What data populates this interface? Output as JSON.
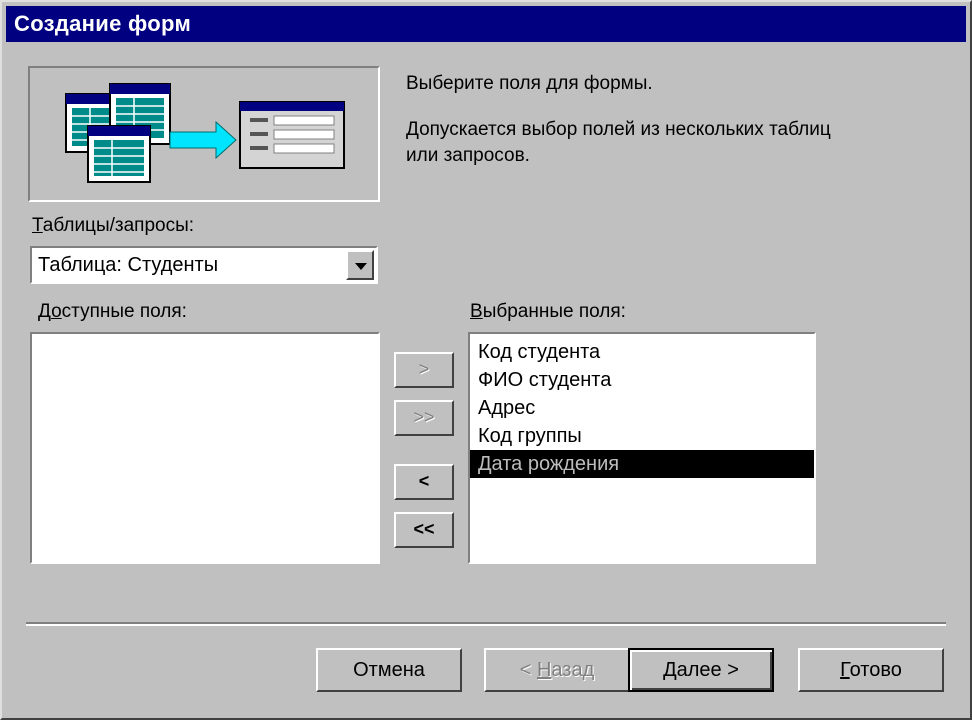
{
  "window": {
    "title": "Создание форм"
  },
  "instructions": {
    "line1": "Выберите поля для формы.",
    "line2": "Допускается выбор полей из нескольких таблиц",
    "line3": "или запросов."
  },
  "tables_label": {
    "u": "Т",
    "rest": "аблицы/запросы:"
  },
  "tables_combo": {
    "value": "Таблица: Студенты",
    "arrow_icon": "chevron-down-icon"
  },
  "available_label": {
    "pre": "Д",
    "u": "о",
    "rest": "ступные поля:"
  },
  "available_fields": [],
  "selected_label": {
    "u": "В",
    "rest": "ыбранные поля:"
  },
  "selected_fields": [
    "Код студента",
    "ФИО студента",
    "Адрес",
    "Код группы",
    "Дата рождения"
  ],
  "selected_index": 4,
  "move_buttons": {
    "add_one": ">",
    "add_all": ">>",
    "remove_one": "<",
    "remove_all": "<<"
  },
  "footer": {
    "cancel": "Отмена",
    "back": {
      "prefix": "< ",
      "u": "Н",
      "rest": "азад"
    },
    "next": {
      "u": "Д",
      "rest": "алее >"
    },
    "finish": {
      "u": "Г",
      "rest": "отово"
    }
  },
  "colors": {
    "title_bg": "#000080",
    "face": "#c0c0c0",
    "arrow": "#00e5ff",
    "table_header": "#000080",
    "table_rows": "#008b8b"
  }
}
